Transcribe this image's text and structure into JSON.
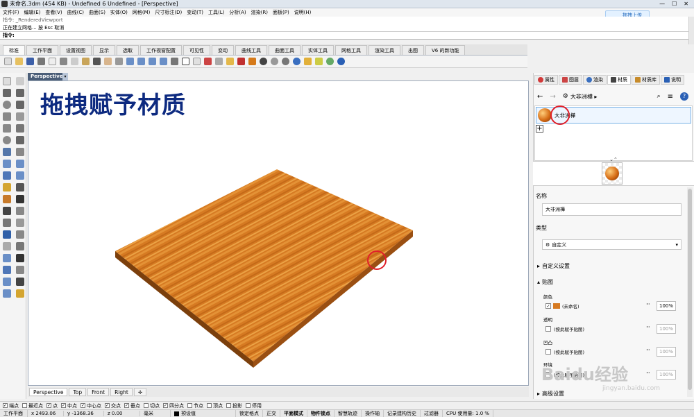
{
  "window": {
    "title": "未命名.3dm (454 KB) - Undefined 6 Undefined - [Perspective]"
  },
  "menu": [
    "文件(F)",
    "编辑(E)",
    "查看(V)",
    "曲线(C)",
    "曲面(S)",
    "实体(O)",
    "网格(M)",
    "尺寸标注(D)",
    "变动(T)",
    "工具(L)",
    "分析(A)",
    "渲染(R)",
    "面板(P)",
    "说明(H)"
  ],
  "upload_label": "拖拽上传",
  "cmd_history": [
    "指令: _RenderedViewport",
    "正在建立网格... 按 Esc 取消"
  ],
  "cmd_prompt": "指令:",
  "tabs": [
    {
      "label": "标准",
      "active": true
    },
    {
      "label": "工作平面"
    },
    {
      "label": "设置视图"
    },
    {
      "label": "显示"
    },
    {
      "label": "选取"
    },
    {
      "label": "工作视窗配置"
    },
    {
      "label": "可见性"
    },
    {
      "label": "变动"
    },
    {
      "label": "曲线工具"
    },
    {
      "label": "曲面工具"
    },
    {
      "label": "实体工具"
    },
    {
      "label": "网格工具"
    },
    {
      "label": "渲染工具"
    },
    {
      "label": "出图"
    },
    {
      "label": "V6 的新功能"
    }
  ],
  "viewport": {
    "label": "Perspective",
    "overlay_title": "拖拽赋予材质"
  },
  "viewport_tabs": [
    "Perspective",
    "Top",
    "Front",
    "Right"
  ],
  "osnaps": [
    {
      "label": "端点",
      "checked": true
    },
    {
      "label": "最近点",
      "checked": false
    },
    {
      "label": "点",
      "checked": true
    },
    {
      "label": "中点",
      "checked": true
    },
    {
      "label": "中心点",
      "checked": true
    },
    {
      "label": "交点",
      "checked": true
    },
    {
      "label": "垂点",
      "checked": true
    },
    {
      "label": "切点",
      "checked": false
    },
    {
      "label": "四分点",
      "checked": true
    },
    {
      "label": "节点",
      "checked": false
    },
    {
      "label": "顶点",
      "checked": false
    },
    {
      "label": "投影",
      "checked": false
    },
    {
      "label": "停用",
      "checked": false
    }
  ],
  "status": {
    "plane": "工作平面",
    "x": "x 2493.06",
    "y": "y -1368.36",
    "z": "z 0.00",
    "unit": "毫米",
    "layer": "预设值",
    "items": [
      {
        "label": "锁定格点",
        "bold": false
      },
      {
        "label": "正交",
        "bold": false
      },
      {
        "label": "平面模式",
        "bold": true
      },
      {
        "label": "物件锁点",
        "bold": true
      },
      {
        "label": "智慧轨迹",
        "bold": false
      },
      {
        "label": "操作轴",
        "bold": false
      },
      {
        "label": "记录建构历史",
        "bold": false
      },
      {
        "label": "过滤器",
        "bold": false
      },
      {
        "label": "CPU 使用量: 1.0 %",
        "bold": false
      }
    ]
  },
  "panel": {
    "tabs": [
      {
        "label": "属性",
        "icon": "properties-icon",
        "color": "#d23a3a"
      },
      {
        "label": "图层",
        "icon": "layers-icon",
        "color": "#c44"
      },
      {
        "label": "渲染",
        "icon": "render-icon",
        "color": "#3a6fc0"
      },
      {
        "label": "材质",
        "icon": "material-icon",
        "color": "#444",
        "active": true
      },
      {
        "label": "材质库",
        "icon": "library-icon",
        "color": "#c78b2a"
      },
      {
        "label": "说明",
        "icon": "help-icon",
        "color": "#2a60b5"
      }
    ],
    "breadcrumb": "大非洲樺 ▸",
    "material_name": "大非洲樺",
    "name_label": "名称",
    "name_value": "大非洲樺",
    "type_label": "类型",
    "type_value": "自定义",
    "custom_settings": "自定义设置",
    "textures_label": "贴图",
    "color_label": "颜色",
    "color_tex": "(未命名)",
    "color_pct": "100%",
    "transparency_label": "透明",
    "transparency_tex": "(按此赋予贴图)",
    "transparency_pct": "100%",
    "bump_label": "凹凸",
    "bump_tex": "(按此赋予贴图)",
    "bump_pct": "100%",
    "env_label": "环境",
    "env_tex": "(按此赋予贴图)",
    "env_pct": "100%",
    "more_label": "高级设置"
  },
  "watermark": "Baidu经验",
  "watermark_url": "jingyan.baidu.com"
}
